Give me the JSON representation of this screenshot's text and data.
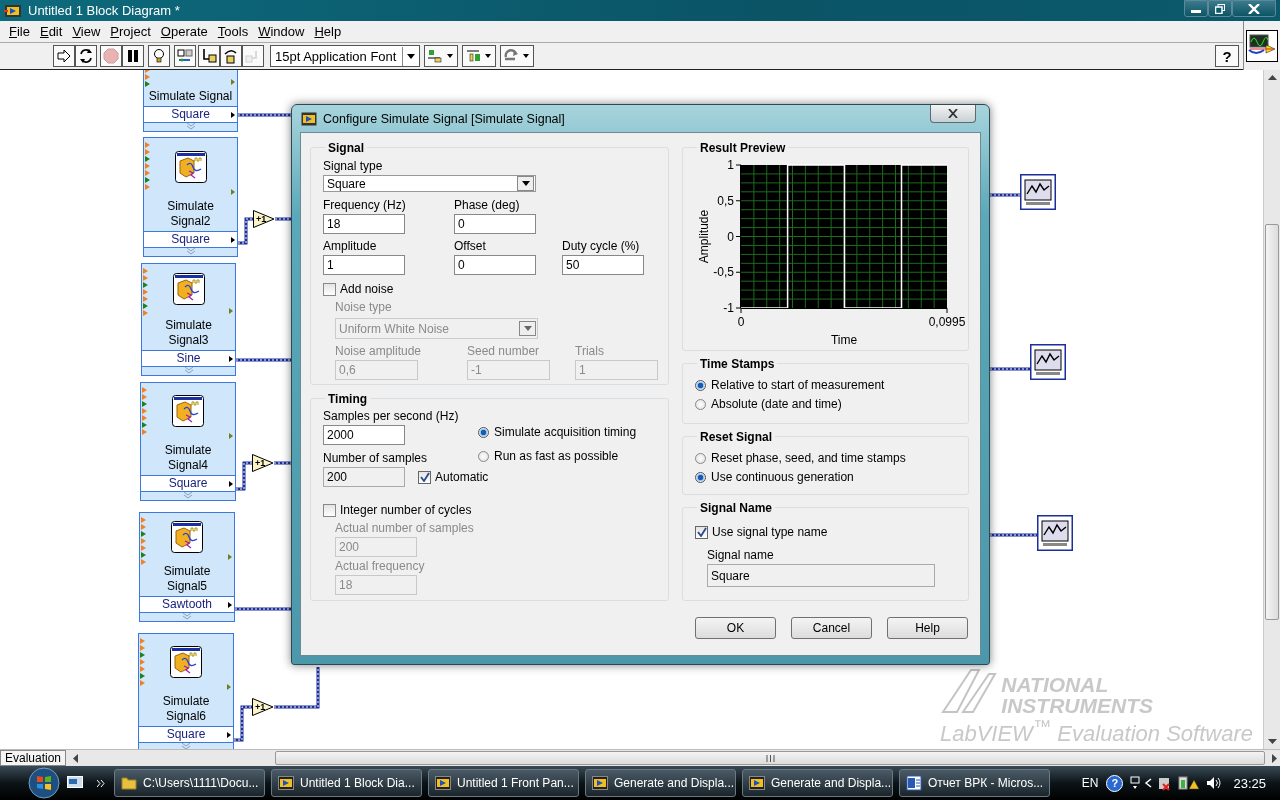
{
  "window": {
    "title": "Untitled 1 Block Diagram *"
  },
  "menu": [
    "File",
    "Edit",
    "View",
    "Project",
    "Operate",
    "Tools",
    "Window",
    "Help"
  ],
  "toolbar": {
    "tools": [
      {
        "kind": "run",
        "disabled": false
      },
      {
        "kind": "run-continuously",
        "disabled": false
      },
      {
        "kind": "abort",
        "disabled": true
      },
      {
        "kind": "pause",
        "disabled": false
      },
      {
        "kind": "highlight",
        "disabled": false
      },
      {
        "kind": "retain",
        "disabled": false
      },
      {
        "kind": "step-into",
        "disabled": false
      },
      {
        "kind": "step-over",
        "disabled": false
      },
      {
        "kind": "step-out",
        "disabled": true
      }
    ],
    "font": "15pt Application Font",
    "layout_tools": [
      {
        "kind": "align"
      },
      {
        "kind": "distribute"
      },
      {
        "kind": "reorder"
      }
    ],
    "help": "?"
  },
  "diagram": {
    "nodes": [
      {
        "title": "Simulate Signal",
        "signal": "Square"
      },
      {
        "title": "Simulate Signal2",
        "signal": "Square",
        "operator": "+1"
      },
      {
        "title": "Simulate Signal3",
        "signal": "Sine"
      },
      {
        "title": "Simulate Signal4",
        "signal": "Square",
        "operator": "+1"
      },
      {
        "title": "Simulate Signal5",
        "signal": "Sawtooth"
      },
      {
        "title": "Simulate Signal6",
        "signal": "Square",
        "operator": "+1"
      }
    ],
    "watermark": {
      "brand": [
        "NATIONAL",
        "INSTRUMENTS"
      ],
      "product": "LabVIEW$^{™}$ Evaluation Software"
    }
  },
  "dialog": {
    "title": "Configure Simulate Signal [Simulate Signal]",
    "signal": {
      "legend": "Signal",
      "type_label": "Signal type",
      "type_value": "Square",
      "fields": [
        {
          "label": "Frequency (Hz)",
          "value": "18"
        },
        {
          "label": "Phase (deg)",
          "value": "0"
        },
        {
          "label": "Amplitude",
          "value": "1"
        },
        {
          "label": "Offset",
          "value": "0"
        },
        {
          "label": "Duty cycle (%)",
          "value": "50"
        }
      ],
      "add_noise": {
        "label": "Add noise",
        "checked": false
      },
      "noise_type": {
        "label": "Noise type",
        "value": "Uniform White Noise",
        "disabled": true
      },
      "noise_fields": [
        {
          "label": "Noise amplitude",
          "value": "0,6",
          "disabled": true
        },
        {
          "label": "Seed number",
          "value": "-1",
          "disabled": true
        },
        {
          "label": "Trials",
          "value": "1",
          "disabled": true
        }
      ]
    },
    "timing": {
      "legend": "Timing",
      "rate": {
        "label": "Samples per second (Hz)",
        "value": "2000",
        "disabled": false
      },
      "modes": [
        {
          "label": "Simulate acquisition timing",
          "selected": true
        },
        {
          "label": "Run as fast as possible",
          "selected": false
        }
      ],
      "samples": {
        "label": "Number of samples",
        "value": "200",
        "disabled": true
      },
      "automatic": {
        "label": "Automatic",
        "checked": true
      },
      "integer_cycles": {
        "label": "Integer number of cycles",
        "checked": false
      },
      "actual": [
        {
          "label": "Actual number of samples",
          "value": "200",
          "disabled": true
        },
        {
          "label": "Actual frequency",
          "value": "18",
          "disabled": true
        }
      ]
    },
    "preview": {
      "legend": "Result Preview",
      "chart_data": {
        "type": "line",
        "grid": true,
        "xlabel": "Time",
        "ylabel": "Amplitude",
        "x": [
          0,
          0.0225,
          0.0225,
          0.05,
          0.05,
          0.0775,
          0.0775,
          0.0995
        ],
        "series": [
          {
            "color": "#ffffff",
            "values": [
              -1,
              -1,
              1,
              1,
              -1,
              -1,
              1,
              1
            ]
          }
        ],
        "xlim": [
          0,
          0.0995
        ],
        "ylim": [
          -1,
          1
        ],
        "xticks": [
          {
            "value": 0,
            "label": "0"
          },
          {
            "value": 0.0995,
            "label": "0,0995"
          }
        ],
        "yticks": [
          {
            "value": 1,
            "label": "1"
          },
          {
            "value": 0.5,
            "label": "0,5"
          },
          {
            "value": 0,
            "label": "0"
          },
          {
            "value": -0.5,
            "label": "-0,5"
          },
          {
            "value": -1,
            "label": "-1"
          }
        ]
      }
    },
    "time_stamps": {
      "legend": "Time Stamps",
      "options": [
        {
          "label": "Relative to start of measurement",
          "selected": true
        },
        {
          "label": "Absolute (date and time)",
          "selected": false
        }
      ]
    },
    "reset_signal": {
      "legend": "Reset Signal",
      "options": [
        {
          "label": "Reset phase, seed, and time stamps",
          "selected": false
        },
        {
          "label": "Use continuous generation",
          "selected": true
        }
      ]
    },
    "signal_name": {
      "legend": "Signal Name",
      "use_type_name": {
        "label": "Use signal type name",
        "checked": true
      },
      "name_label": "Signal name",
      "name_value": "Square",
      "disabled": true
    },
    "buttons": [
      "OK",
      "Cancel",
      "Help"
    ]
  },
  "status_bar": {
    "label": "Evaluation"
  },
  "taskbar": {
    "tasks": [
      {
        "label": "C:\\Users\\1111\\Docu...",
        "kind": "folder"
      },
      {
        "label": "Untitled 1 Block Dia...",
        "kind": "labview"
      },
      {
        "label": "Untitled 1 Front Pan...",
        "kind": "labview"
      },
      {
        "label": "Generate and Displa...",
        "kind": "labview"
      },
      {
        "label": "Generate and Displa...",
        "kind": "labview"
      },
      {
        "label": "Отчет ВРК - Micros...",
        "kind": "word"
      }
    ],
    "language": "EN",
    "help": "?",
    "clock": "23:25"
  }
}
